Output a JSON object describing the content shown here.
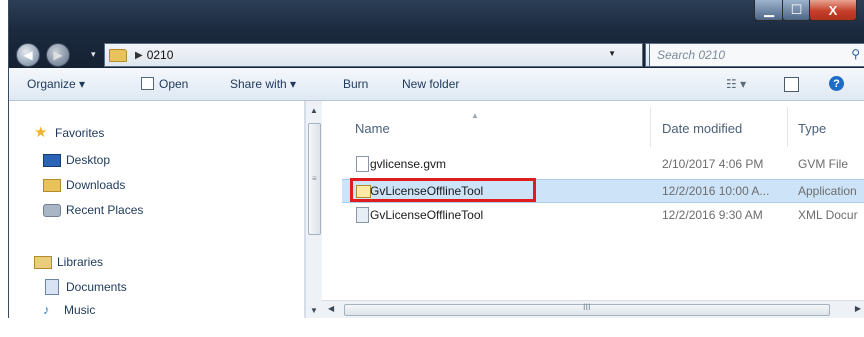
{
  "window": {
    "minimize_icon": "minimize-icon",
    "maximize_icon": "maximize-icon",
    "close_label": "X"
  },
  "nav": {
    "back_icon": "back-arrow-icon",
    "forward_icon": "forward-arrow-icon"
  },
  "address": {
    "breadcrumb": "0210"
  },
  "search": {
    "placeholder": "Search 0210"
  },
  "toolbar": {
    "organize": "Organize ▾",
    "open": "Open",
    "share_with": "Share with ▾",
    "burn": "Burn",
    "new_folder": "New folder"
  },
  "sidebar": {
    "favorites_header": "Favorites",
    "favorites": [
      {
        "label": "Desktop",
        "icon": "desktop-icon"
      },
      {
        "label": "Downloads",
        "icon": "downloads-folder-icon"
      },
      {
        "label": "Recent Places",
        "icon": "recent-places-icon"
      }
    ],
    "libraries_header": "Libraries",
    "libraries": [
      {
        "label": "Documents",
        "icon": "documents-icon"
      },
      {
        "label": "Music",
        "icon": "music-icon"
      }
    ]
  },
  "columns": {
    "name": "Name",
    "date": "Date modified",
    "type": "Type"
  },
  "files": [
    {
      "name": "gvlicense.gvm",
      "date": "2/10/2017 4:06 PM",
      "type": "GVM File",
      "icon": "document-file-icon"
    },
    {
      "name": "GvLicenseOfflineTool",
      "date": "12/2/2016 10:00 A...",
      "type": "Application",
      "icon": "application-icon",
      "selected": true
    },
    {
      "name": "GvLicenseOfflineTool",
      "date": "12/2/2016 9:30 AM",
      "type": "XML Docur",
      "icon": "xml-file-icon"
    }
  ],
  "colors": {
    "selection": "#cde3f8",
    "highlight_box": "#e01c1c",
    "titlebar": "#1b2a3e"
  }
}
